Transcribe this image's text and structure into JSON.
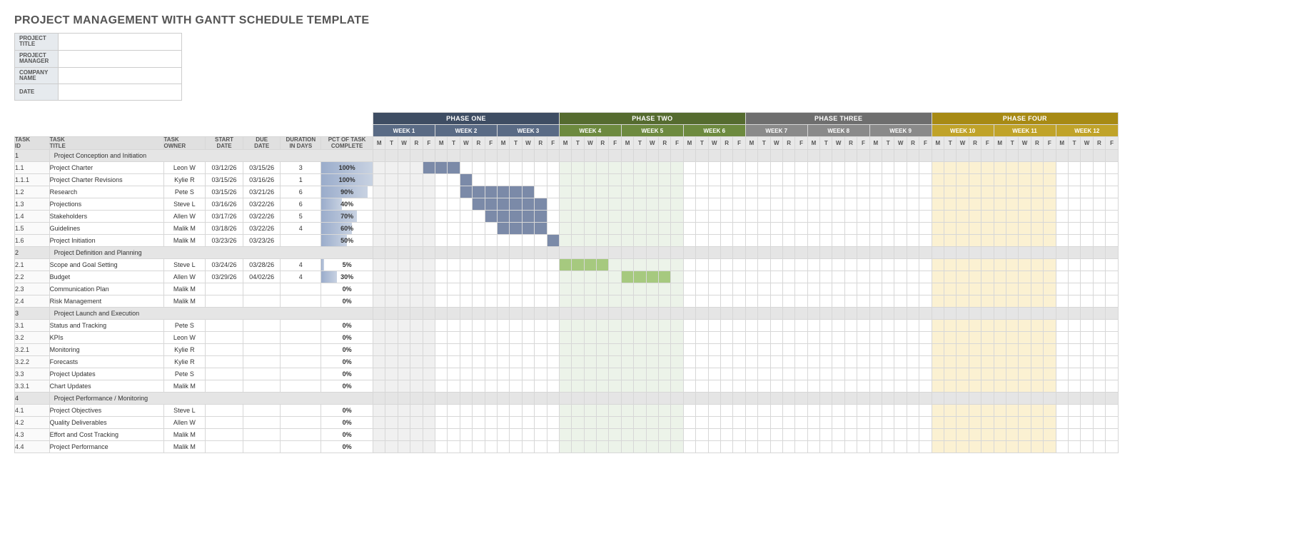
{
  "title": "PROJECT MANAGEMENT WITH GANTT SCHEDULE TEMPLATE",
  "meta": [
    {
      "label": "PROJECT TITLE",
      "value": ""
    },
    {
      "label": "PROJECT MANAGER",
      "value": ""
    },
    {
      "label": "COMPANY NAME",
      "value": ""
    },
    {
      "label": "DATE",
      "value": ""
    }
  ],
  "columns": {
    "id": "TASK ID",
    "title": "TASK TITLE",
    "owner": "TASK OWNER",
    "start": "START DATE",
    "due": "DUE DATE",
    "dur": "DURATION IN DAYS",
    "pct": "PCT OF TASK COMPLETE"
  },
  "dows": [
    "M",
    "T",
    "W",
    "R",
    "F"
  ],
  "phases": [
    {
      "name": "PHASE ONE",
      "weeks": [
        "WEEK 1",
        "WEEK 2",
        "WEEK 3"
      ],
      "ph": "ph-1",
      "wk": "wk-1",
      "shade": [
        1
      ],
      "barClass": "bar1"
    },
    {
      "name": "PHASE TWO",
      "weeks": [
        "WEEK 4",
        "WEEK 5",
        "WEEK 6"
      ],
      "ph": "ph-2",
      "wk": "wk-2",
      "shade": [
        4,
        5
      ],
      "barClass": "bar2",
      "shadeClass": "sh2"
    },
    {
      "name": "PHASE THREE",
      "weeks": [
        "WEEK 7",
        "WEEK 8",
        "WEEK 9"
      ],
      "ph": "ph-3",
      "wk": "wk-3",
      "shade": []
    },
    {
      "name": "PHASE FOUR",
      "weeks": [
        "WEEK 10",
        "WEEK 11",
        "WEEK 12"
      ],
      "ph": "ph-4",
      "wk": "wk-4",
      "shade": [
        10,
        11
      ],
      "shadeClass": "sh3"
    }
  ],
  "chart_data": {
    "type": "gantt",
    "time_axis": {
      "unit": "weekday",
      "labels": [
        "M",
        "T",
        "W",
        "R",
        "F"
      ],
      "weeks": 12,
      "phases": [
        "PHASE ONE",
        "PHASE TWO",
        "PHASE THREE",
        "PHASE FOUR"
      ]
    },
    "tasks": [
      {
        "id": "1",
        "title": "Project Conception and Initiation",
        "section": true
      },
      {
        "id": "1.1",
        "title": "Project Charter",
        "owner": "Leon W",
        "start": "03/12/26",
        "due": "03/15/26",
        "dur": 3,
        "pct": 100,
        "bar": [
          4,
          6
        ],
        "indent": 1
      },
      {
        "id": "1.1.1",
        "title": "Project Charter Revisions",
        "owner": "Kylie R",
        "start": "03/15/26",
        "due": "03/16/26",
        "dur": 1,
        "pct": 100,
        "bar": [
          7,
          7
        ],
        "indent": 2
      },
      {
        "id": "1.2",
        "title": "Research",
        "owner": "Pete S",
        "start": "03/15/26",
        "due": "03/21/26",
        "dur": 6,
        "pct": 90,
        "bar": [
          7,
          12
        ],
        "indent": 1
      },
      {
        "id": "1.3",
        "title": "Projections",
        "owner": "Steve L",
        "start": "03/16/26",
        "due": "03/22/26",
        "dur": 6,
        "pct": 40,
        "bar": [
          8,
          13
        ],
        "indent": 1
      },
      {
        "id": "1.4",
        "title": "Stakeholders",
        "owner": "Allen W",
        "start": "03/17/26",
        "due": "03/22/26",
        "dur": 5,
        "pct": 70,
        "bar": [
          9,
          13
        ],
        "indent": 1
      },
      {
        "id": "1.5",
        "title": "Guidelines",
        "owner": "Malik M",
        "start": "03/18/26",
        "due": "03/22/26",
        "dur": 4,
        "pct": 60,
        "bar": [
          10,
          13
        ],
        "indent": 1
      },
      {
        "id": "1.6",
        "title": "Project Initiation",
        "owner": "Malik M",
        "start": "03/23/26",
        "due": "03/23/26",
        "dur": "",
        "pct": 50,
        "bar": [
          14,
          14
        ],
        "indent": 1
      },
      {
        "id": "2",
        "title": "Project Definition and Planning",
        "section": true
      },
      {
        "id": "2.1",
        "title": "Scope and Goal Setting",
        "owner": "Steve L",
        "start": "03/24/26",
        "due": "03/28/26",
        "dur": 4,
        "pct": 5,
        "bar": [
          15,
          18
        ],
        "barClass": "bar2",
        "indent": 1
      },
      {
        "id": "2.2",
        "title": "Budget",
        "owner": "Allen W",
        "start": "03/29/26",
        "due": "04/02/26",
        "dur": 4,
        "pct": 30,
        "bar": [
          20,
          23
        ],
        "barClass": "bar2",
        "indent": 1
      },
      {
        "id": "2.3",
        "title": "Communication Plan",
        "owner": "Malik M",
        "start": "",
        "due": "",
        "dur": "",
        "pct": 0,
        "indent": 1
      },
      {
        "id": "2.4",
        "title": "Risk Management",
        "owner": "Malik M",
        "start": "",
        "due": "",
        "dur": "",
        "pct": 0,
        "indent": 1
      },
      {
        "id": "3",
        "title": "Project Launch and Execution",
        "section": true
      },
      {
        "id": "3.1",
        "title": "Status and Tracking",
        "owner": "Pete S",
        "start": "",
        "due": "",
        "dur": "",
        "pct": 0,
        "indent": 1
      },
      {
        "id": "3.2",
        "title": "KPIs",
        "owner": "Leon W",
        "start": "",
        "due": "",
        "dur": "",
        "pct": 0,
        "indent": 1
      },
      {
        "id": "3.2.1",
        "title": "Monitoring",
        "owner": "Kylie R",
        "start": "",
        "due": "",
        "dur": "",
        "pct": 0,
        "indent": 2
      },
      {
        "id": "3.2.2",
        "title": "Forecasts",
        "owner": "Kylie R",
        "start": "",
        "due": "",
        "dur": "",
        "pct": 0,
        "indent": 2
      },
      {
        "id": "3.3",
        "title": "Project Updates",
        "owner": "Pete S",
        "start": "",
        "due": "",
        "dur": "",
        "pct": 0,
        "indent": 1
      },
      {
        "id": "3.3.1",
        "title": "Chart Updates",
        "owner": "Malik M",
        "start": "",
        "due": "",
        "dur": "",
        "pct": 0,
        "indent": 2
      },
      {
        "id": "4",
        "title": "Project Performance / Monitoring",
        "section": true
      },
      {
        "id": "4.1",
        "title": "Project Objectives",
        "owner": "Steve L",
        "start": "",
        "due": "",
        "dur": "",
        "pct": 0,
        "indent": 1
      },
      {
        "id": "4.2",
        "title": "Quality Deliverables",
        "owner": "Allen W",
        "start": "",
        "due": "",
        "dur": "",
        "pct": 0,
        "indent": 1
      },
      {
        "id": "4.3",
        "title": "Effort and Cost Tracking",
        "owner": "Malik M",
        "start": "",
        "due": "",
        "dur": "",
        "pct": 0,
        "indent": 1
      },
      {
        "id": "4.4",
        "title": "Project Performance",
        "owner": "Malik M",
        "start": "",
        "due": "",
        "dur": "",
        "pct": 0,
        "indent": 1
      }
    ]
  }
}
